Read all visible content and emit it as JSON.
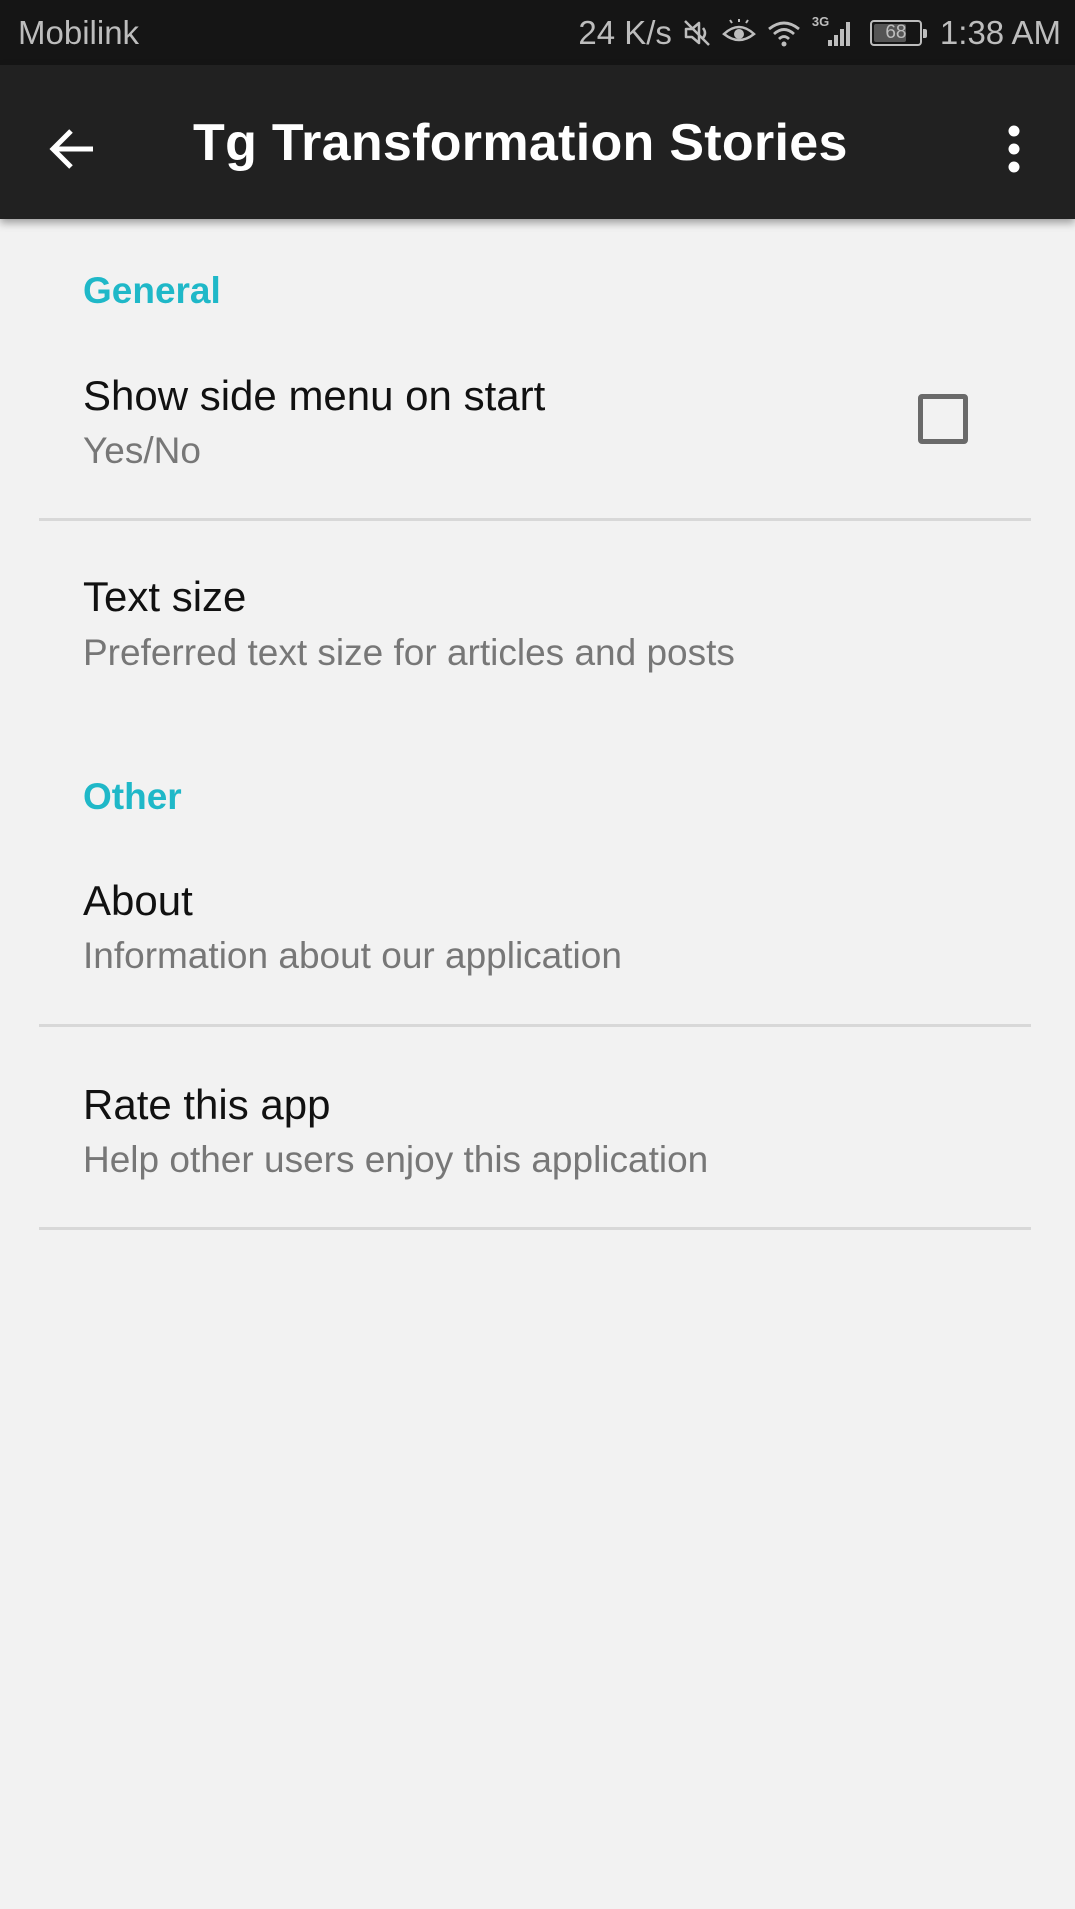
{
  "status_bar": {
    "carrier": "Mobilink",
    "net_speed": "24 K/s",
    "network_type": "3G",
    "battery": "68",
    "time": "1:38 AM",
    "icons": [
      "mute-icon",
      "eye-icon",
      "wifi-icon",
      "signal-icon",
      "battery-icon"
    ]
  },
  "app_bar": {
    "title": "Tg Transformation Stories",
    "back_icon": "arrow-back-icon",
    "menu_icon": "more-vert-icon"
  },
  "sections": [
    {
      "header": "General",
      "items": [
        {
          "title": "Show side menu on start",
          "summary": "Yes/No",
          "checkbox_checked": false
        },
        {
          "title": "Text size",
          "summary": "Preferred text size for articles and posts"
        }
      ]
    },
    {
      "header": "Other",
      "items": [
        {
          "title": "About",
          "summary": "Information about our application"
        },
        {
          "title": "Rate this app",
          "summary": "Help other users enjoy this application"
        }
      ]
    }
  ],
  "colors": {
    "accent": "#1fb8c8",
    "app_bar": "#212121",
    "status_bar": "#151515",
    "background": "#f2f2f2"
  }
}
